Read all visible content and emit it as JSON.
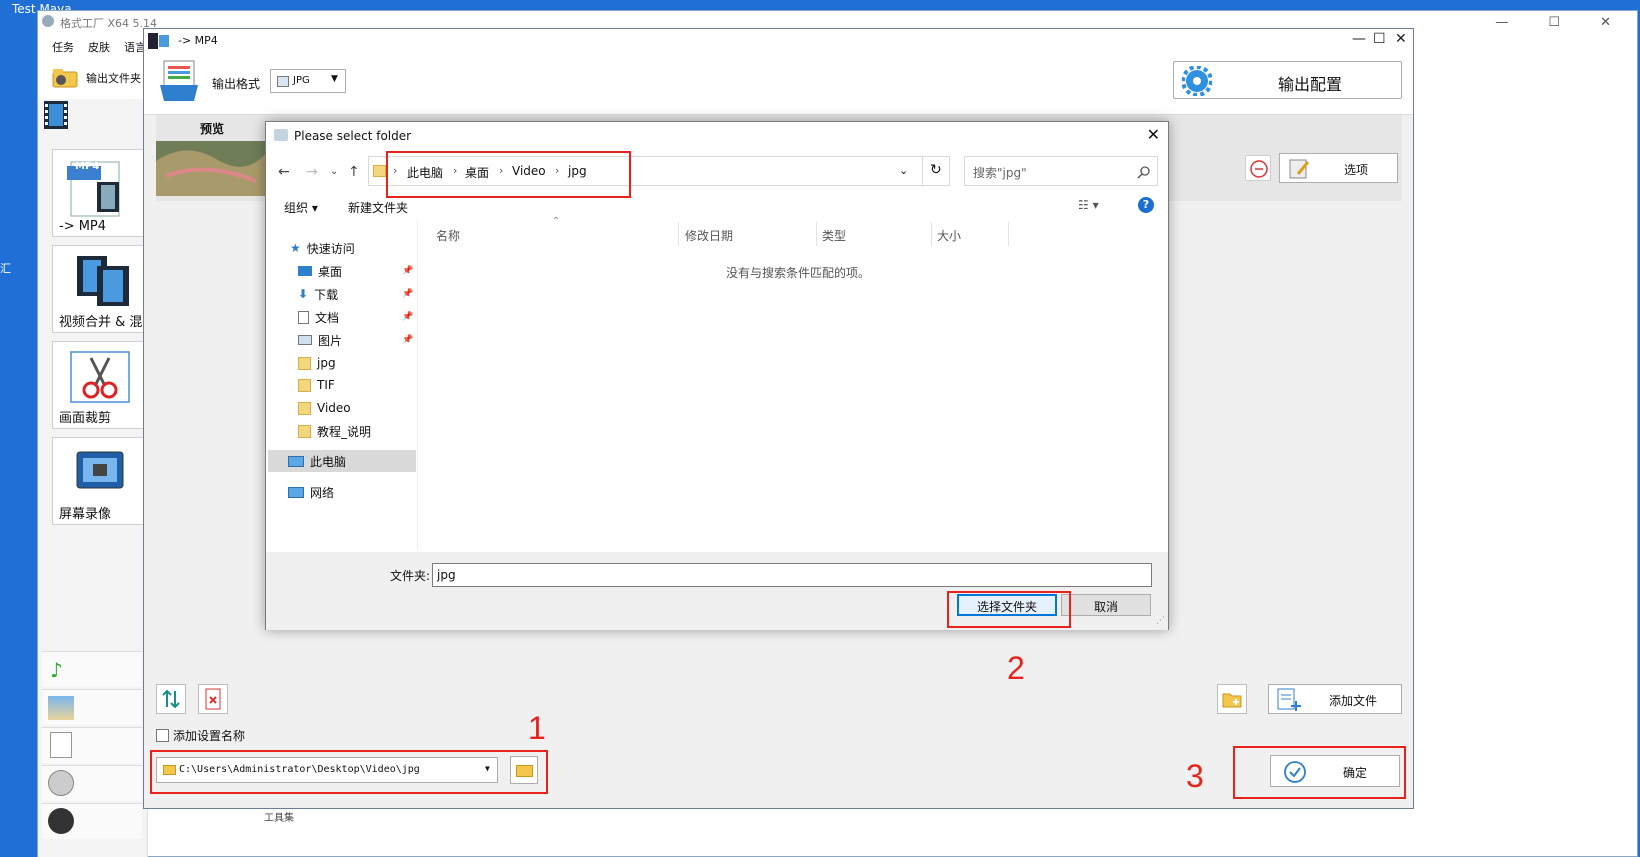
{
  "desktop": {
    "title": "Test Maya",
    "left_strip_text": "汇"
  },
  "bg_app": {
    "title": "格式工厂 X64 5.14",
    "menu": [
      "任务",
      "皮肤",
      "语言"
    ],
    "output_folder_label": "输出文件夹",
    "tools": [
      "-> MP4",
      "视频合并 & 混",
      "画面裁剪",
      "屏幕录像"
    ],
    "mp4_badge": "MP4",
    "toolset_label": "工具集"
  },
  "mp4_window": {
    "title": "-> MP4",
    "output_format_label": "输出格式",
    "format_value": "JPG",
    "output_config_label": "输出配置",
    "preview_label": "预览",
    "options_label": "选项",
    "add_file_label": "添加文件",
    "add_name_label": "添加设置名称",
    "output_path": "C:\\Users\\Administrator\\Desktop\\Video\\jpg",
    "ok_label": "确定"
  },
  "dialog": {
    "title": "Please select folder",
    "breadcrumb": [
      "此电脑",
      "桌面",
      "Video",
      "jpg"
    ],
    "search_placeholder": "搜索\"jpg\"",
    "toolbar": {
      "organize": "组织",
      "new_folder": "新建文件夹"
    },
    "nav_items": [
      {
        "label": "快速访问",
        "pinned": false
      },
      {
        "label": "桌面",
        "pinned": true
      },
      {
        "label": "下载",
        "pinned": true
      },
      {
        "label": "文档",
        "pinned": true
      },
      {
        "label": "图片",
        "pinned": true
      },
      {
        "label": "jpg",
        "pinned": false
      },
      {
        "label": "TIF",
        "pinned": false
      },
      {
        "label": "Video",
        "pinned": false
      },
      {
        "label": "教程_说明",
        "pinned": false
      },
      {
        "label": "此电脑",
        "pinned": false
      },
      {
        "label": "网络",
        "pinned": false
      }
    ],
    "columns": [
      "名称",
      "修改日期",
      "类型",
      "大小"
    ],
    "empty_message": "没有与搜索条件匹配的项。",
    "folder_label": "文件夹:",
    "folder_value": "jpg",
    "select_button": "选择文件夹",
    "cancel_button": "取消"
  },
  "annotations": {
    "step1": "1",
    "step2": "2",
    "step3": "3",
    "color": "#e8231c"
  }
}
